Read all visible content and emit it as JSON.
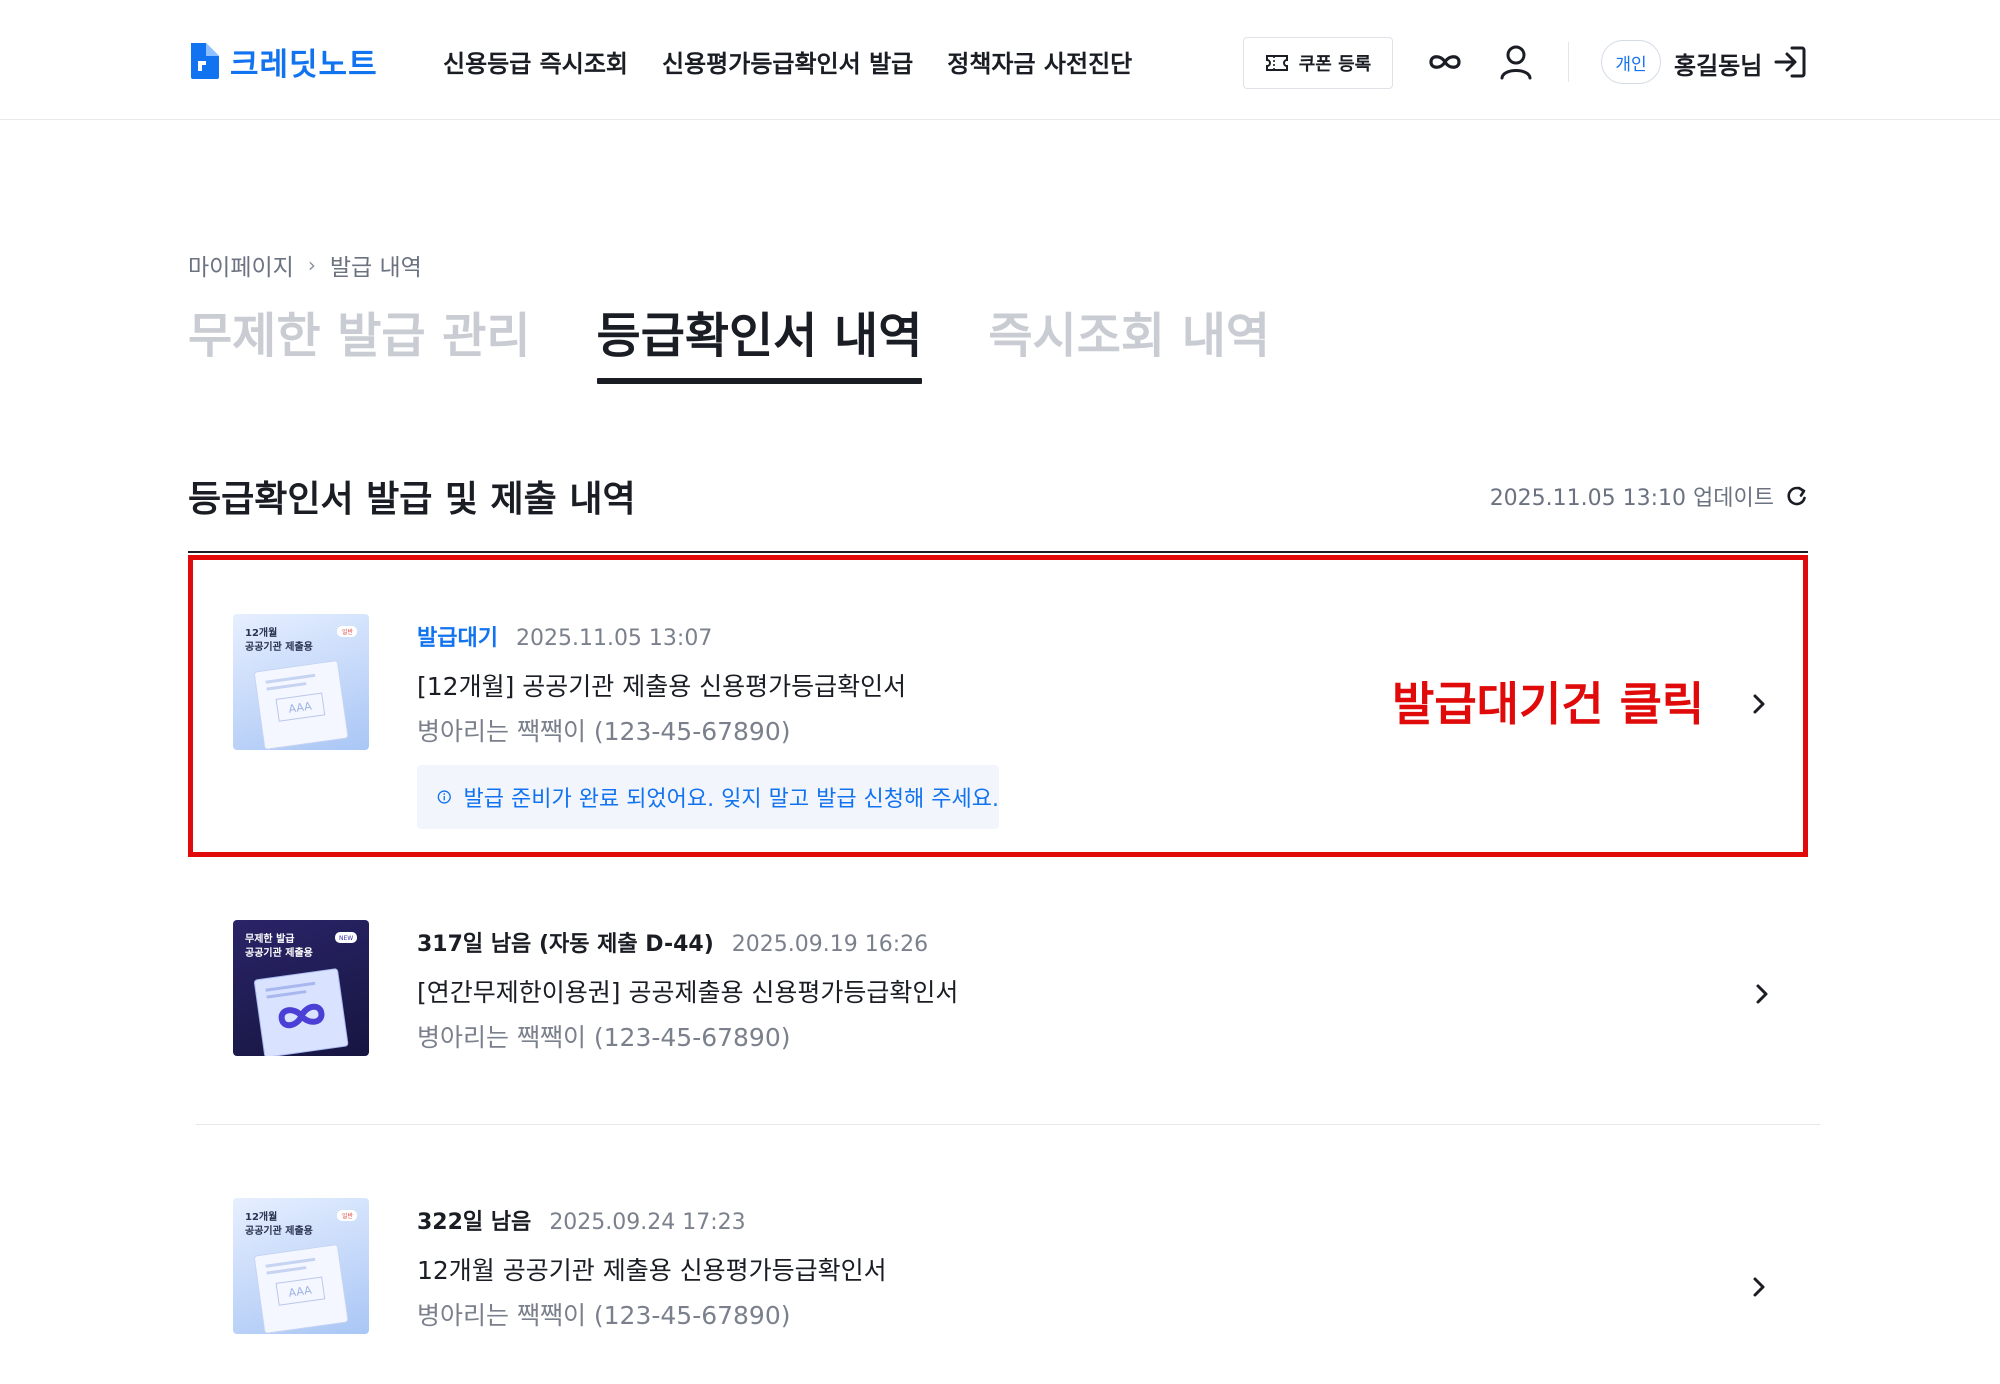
{
  "header": {
    "logo_text": "크레딧노트",
    "nav": [
      "신용등급 즉시조회",
      "신용평가등급확인서 발급",
      "정책자금 사전진단"
    ],
    "coupon_label": "쿠폰 등록",
    "personal_badge": "개인",
    "user_name": "홍길동님"
  },
  "breadcrumb": {
    "root": "마이페이지",
    "separator": "›",
    "current": "발급 내역"
  },
  "tabs": [
    {
      "label": "무제한 발급 관리",
      "active": false
    },
    {
      "label": "등급확인서 내역",
      "active": true
    },
    {
      "label": "즉시조회 내역",
      "active": false
    }
  ],
  "section": {
    "title": "등급확인서 발급 및 제출 내역",
    "updated": "2025.11.05 13:10 업데이트"
  },
  "items": [
    {
      "thumb_title_1": "12개월",
      "thumb_title_2": "공공기관 제출용",
      "thumb_tag": "일반",
      "thumb_grade": "AAA",
      "status": "발급대기",
      "datetime": "2025.11.05 13:07",
      "product": "[12개월] 공공기관 제출용 신용평가등급확인서",
      "company": "병아리는 짹짹이 (123-45-67890)",
      "notice": "발급 준비가 완료 되었어요. 잊지 말고 발급 신청해 주세요."
    },
    {
      "thumb_title_1": "무제한 발급",
      "thumb_title_2": "공공기관 제출용",
      "thumb_tag": "NEW",
      "status": "317일 남음 (자동 제출  D-44)",
      "datetime": "2025.09.19 16:26",
      "product": "[연간무제한이용권] 공공제출용 신용평가등급확인서",
      "company": "병아리는 짹짹이 (123-45-67890)"
    },
    {
      "thumb_title_1": "12개월",
      "thumb_title_2": "공공기관 제출용",
      "thumb_tag": "일반",
      "thumb_grade": "AAA",
      "status": "322일 남음",
      "datetime": "2025.09.24 17:23",
      "product": "12개월 공공기관 제출용 신용평가등급확인서",
      "company": "병아리는 짹짹이 (123-45-67890)"
    }
  ],
  "annotation": "발급대기건 클릭",
  "colors": {
    "brand": "#1273f0",
    "highlight": "#e00a0a",
    "text": "#1a1d24",
    "muted": "#7b818c"
  },
  "icons": [
    "logo-mark-icon",
    "ticket-icon",
    "infinity-icon",
    "person-icon",
    "logout-icon",
    "refresh-icon",
    "info-icon",
    "chevron-right-icon"
  ]
}
